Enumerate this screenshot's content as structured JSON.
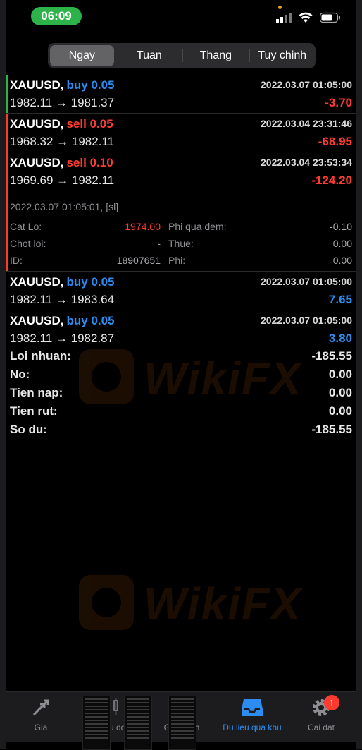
{
  "status": {
    "time": "06:09"
  },
  "tabs": [
    "Ngay",
    "Tuan",
    "Thang",
    "Tuy chinh"
  ],
  "trades": [
    {
      "symbol": "XAUUSD,",
      "side": "buy 0.05",
      "side_type": "buy",
      "datetime": "2022.03.07 01:05:00",
      "prices": "1982.11 → 1981.37",
      "profit": "-3.70",
      "profit_sign": "neg",
      "bar_color": "#2eb34b"
    },
    {
      "symbol": "XAUUSD,",
      "side": "sell 0.05",
      "side_type": "sell",
      "datetime": "2022.03.04 23:31:46",
      "prices": "1968.32 → 1982.11",
      "profit": "-68.95",
      "profit_sign": "neg",
      "bar_color": "#ff3b30"
    },
    {
      "symbol": "XAUUSD,",
      "side": "sell 0.10",
      "side_type": "sell",
      "datetime": "2022.03.04 23:53:34",
      "prices": "1969.69 → 1982.11",
      "profit": "-124.20",
      "profit_sign": "neg",
      "bar_color": "#ff3b30"
    },
    {
      "symbol": "XAUUSD,",
      "side": "buy 0.05",
      "side_type": "buy",
      "datetime": "2022.03.07 01:05:00",
      "prices": "1982.11 → 1983.64",
      "profit": "7.65",
      "profit_sign": "pos",
      "bar_color": ""
    },
    {
      "symbol": "XAUUSD,",
      "side": "buy 0.05",
      "side_type": "buy",
      "datetime": "2022.03.07 01:05:00",
      "prices": "1982.11 → 1982.87",
      "profit": "3.80",
      "profit_sign": "pos",
      "bar_color": ""
    }
  ],
  "detail": {
    "closed": "2022.03.07 01:05:01, [sl]",
    "cat_lo_label": "Cat Lo:",
    "cat_lo_value": "1974.00",
    "chot_loi_label": "Chot loi:",
    "chot_loi_value": "-",
    "id_label": "ID:",
    "id_value": "18907651",
    "phi_qua_dem_label": "Phi qua dem:",
    "phi_qua_dem_value": "-0.10",
    "thue_label": "Thue:",
    "thue_value": "0.00",
    "phi_label": "Phi:",
    "phi_value": "0.00"
  },
  "summary": [
    {
      "label": "Loi nhuan:",
      "value": "-185.55"
    },
    {
      "label": "No:",
      "value": "0.00"
    },
    {
      "label": "Tien nap:",
      "value": "0.00"
    },
    {
      "label": "Tien rut:",
      "value": "0.00"
    },
    {
      "label": "So du:",
      "value": "-185.55"
    }
  ],
  "watermark": "WikiFX",
  "tabbar": {
    "items": [
      "Gia",
      "Bieu do",
      "Giao dich",
      "Du lieu qua khu",
      "Cai dat"
    ],
    "active": "Du lieu qua khu",
    "badge": "1"
  },
  "colors": {
    "buy": "#2d8cf0",
    "sell": "#ff3b30",
    "active_tab": "#2d8cf0",
    "status_green": "#2eb34b"
  }
}
